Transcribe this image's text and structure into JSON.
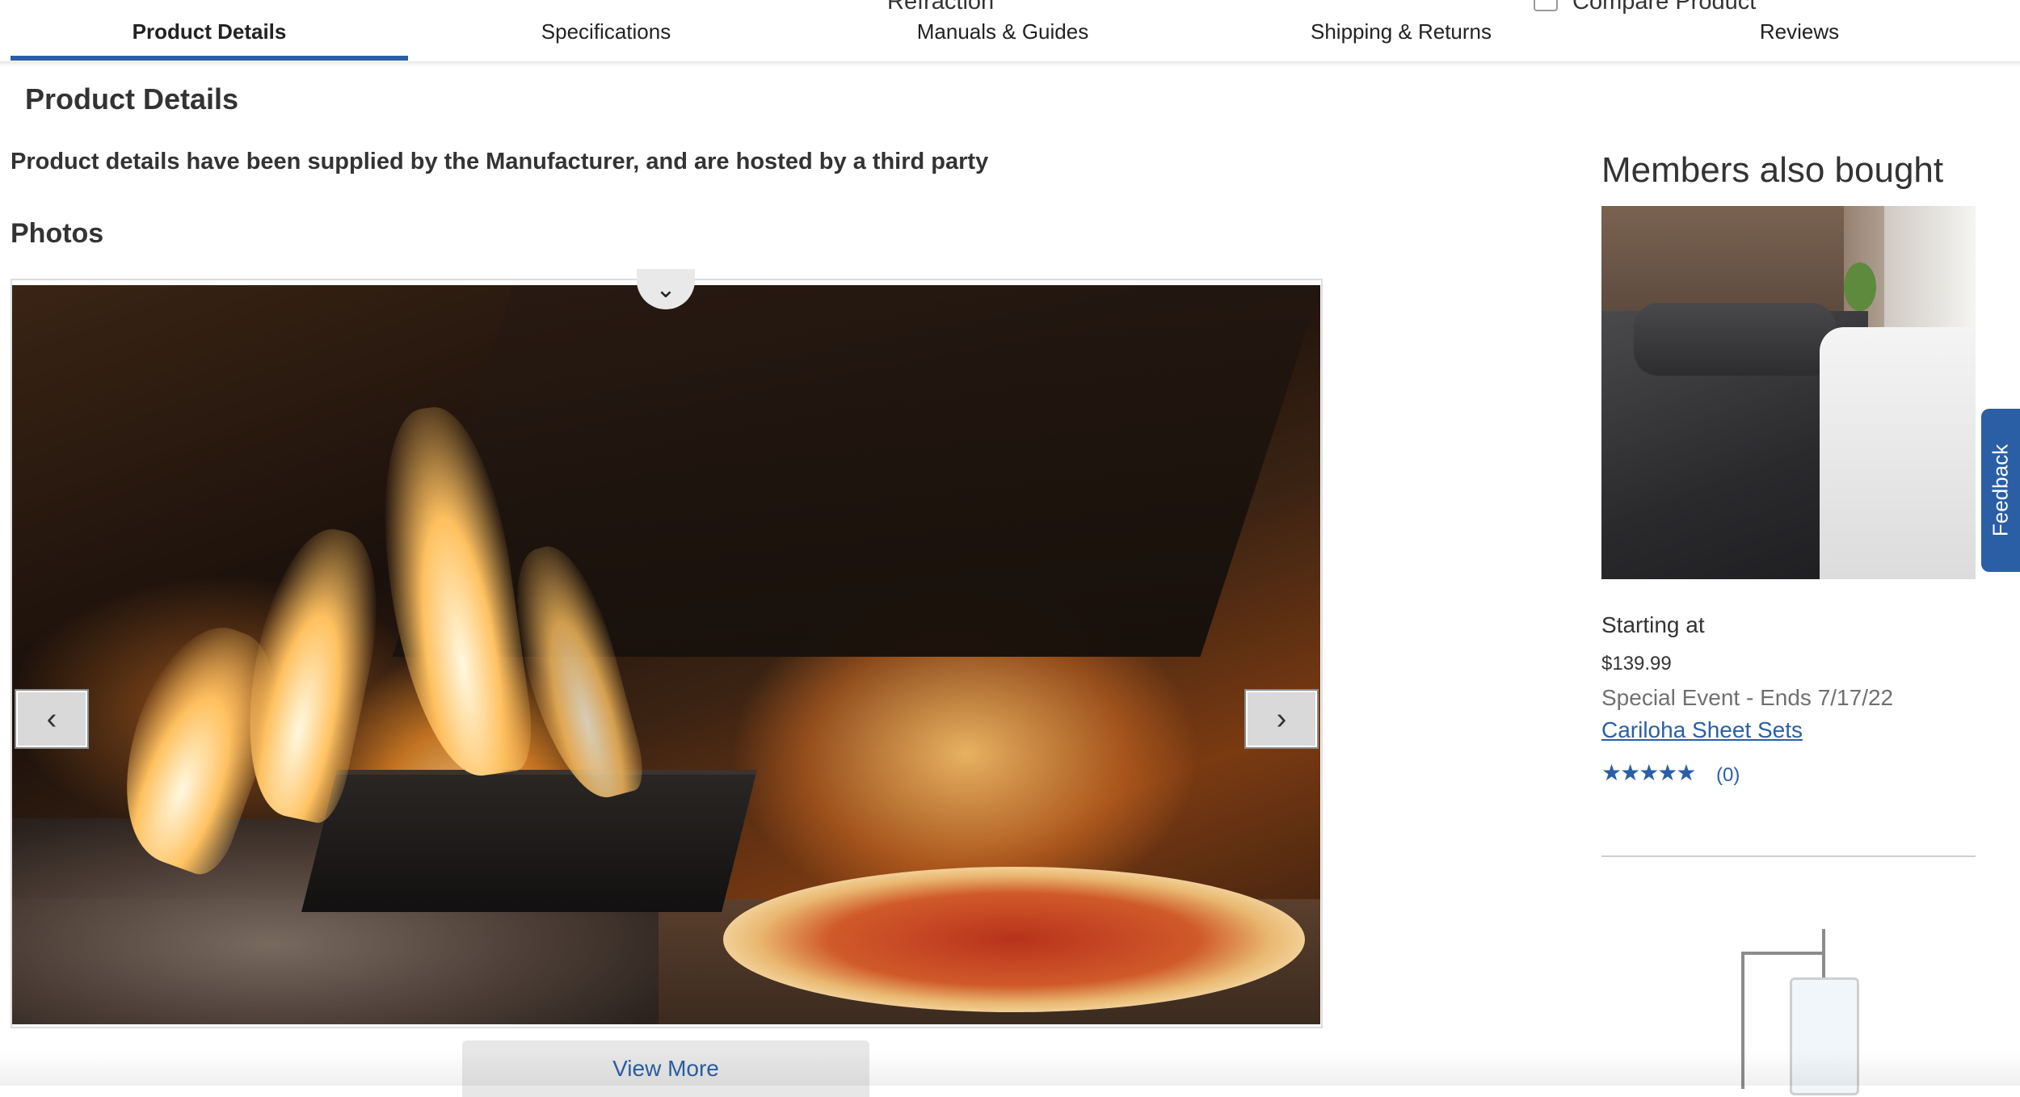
{
  "clipped_top": {
    "refraction_text": "Refraction",
    "compare_label": "Compare Product"
  },
  "tabs": [
    {
      "label": "Product Details",
      "active": true
    },
    {
      "label": "Specifications",
      "active": false
    },
    {
      "label": "Manuals & Guides",
      "active": false
    },
    {
      "label": "Shipping & Returns",
      "active": false
    },
    {
      "label": "Reviews",
      "active": false
    }
  ],
  "main": {
    "section_title": "Product Details",
    "supplied_note": "Product details have been supplied by the Manufacturer, and are hosted by a third party",
    "photos_title": "Photos",
    "view_more_label": "View More",
    "icons": {
      "collapse": "chevron-down-icon",
      "prev": "chevron-left-icon",
      "next": "chevron-right-icon"
    }
  },
  "sidebar": {
    "title": "Members also bought",
    "product": {
      "starting_label": "Starting at",
      "price": "$139.99",
      "event": "Special Event - Ends 7/17/22",
      "name": "Cariloha Sheet Sets",
      "rating_stars": "★★★★★",
      "review_count": "(0)"
    }
  },
  "feedback_label": "Feedback",
  "colors": {
    "accent": "#2a5fa6",
    "text": "#333333",
    "muted": "#707070"
  }
}
